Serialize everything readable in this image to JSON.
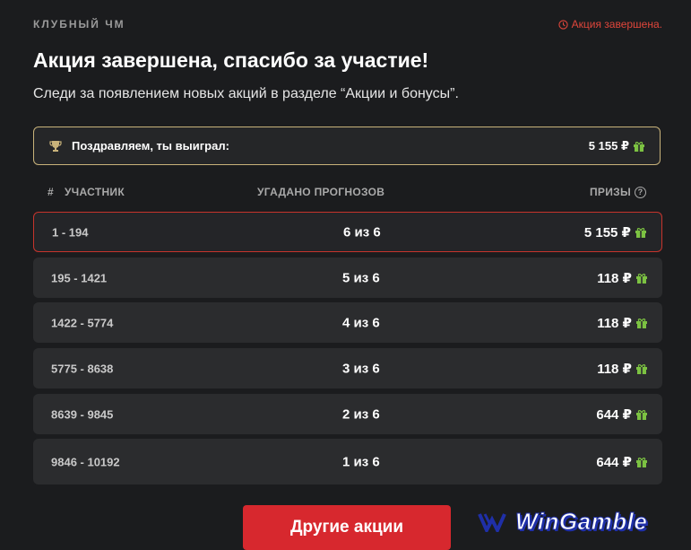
{
  "header": {
    "label": "КЛУБНЫЙ ЧМ",
    "status": "Акция завершена."
  },
  "main": {
    "title": "Акция завершена, спасибо за участие!",
    "subtitle": "Следи за появлением новых акций в разделе “Акции и бонусы”."
  },
  "winner": {
    "text": "Поздравляем, ты выиграл:",
    "amount": "5 155 ₽"
  },
  "table": {
    "col_num": "#",
    "col_participant": "УЧАСТНИК",
    "col_guessed": "УГАДАНО ПРОГНОЗОВ",
    "col_prizes": "ПРИЗЫ",
    "rows": [
      {
        "rank": "1 - 194",
        "guessed": "6 из 6",
        "prize": "5 155 ₽"
      },
      {
        "rank": "195 - 1421",
        "guessed": "5 из 6",
        "prize": "118 ₽"
      },
      {
        "rank": "1422 - 5774",
        "guessed": "4 из 6",
        "prize": "118 ₽"
      },
      {
        "rank": "5775 - 8638",
        "guessed": "3 из 6",
        "prize": "118 ₽"
      },
      {
        "rank": "8639 - 9845",
        "guessed": "2 из 6",
        "prize": "644 ₽"
      },
      {
        "rank": "9846 - 10192",
        "guessed": "1 из 6",
        "prize": "644 ₽"
      }
    ]
  },
  "button": {
    "label": "Другие акции"
  },
  "watermark": {
    "text": "WinGamble"
  },
  "colors": {
    "accent_red": "#d7282e",
    "gift_green": "#7cc242",
    "winner_border": "#c8b27a",
    "background": "#1b1c1e"
  },
  "icons": {
    "status": "clock-icon",
    "winner": "trophy-icon",
    "prize": "gift-icon",
    "help": "question-circle-icon"
  }
}
